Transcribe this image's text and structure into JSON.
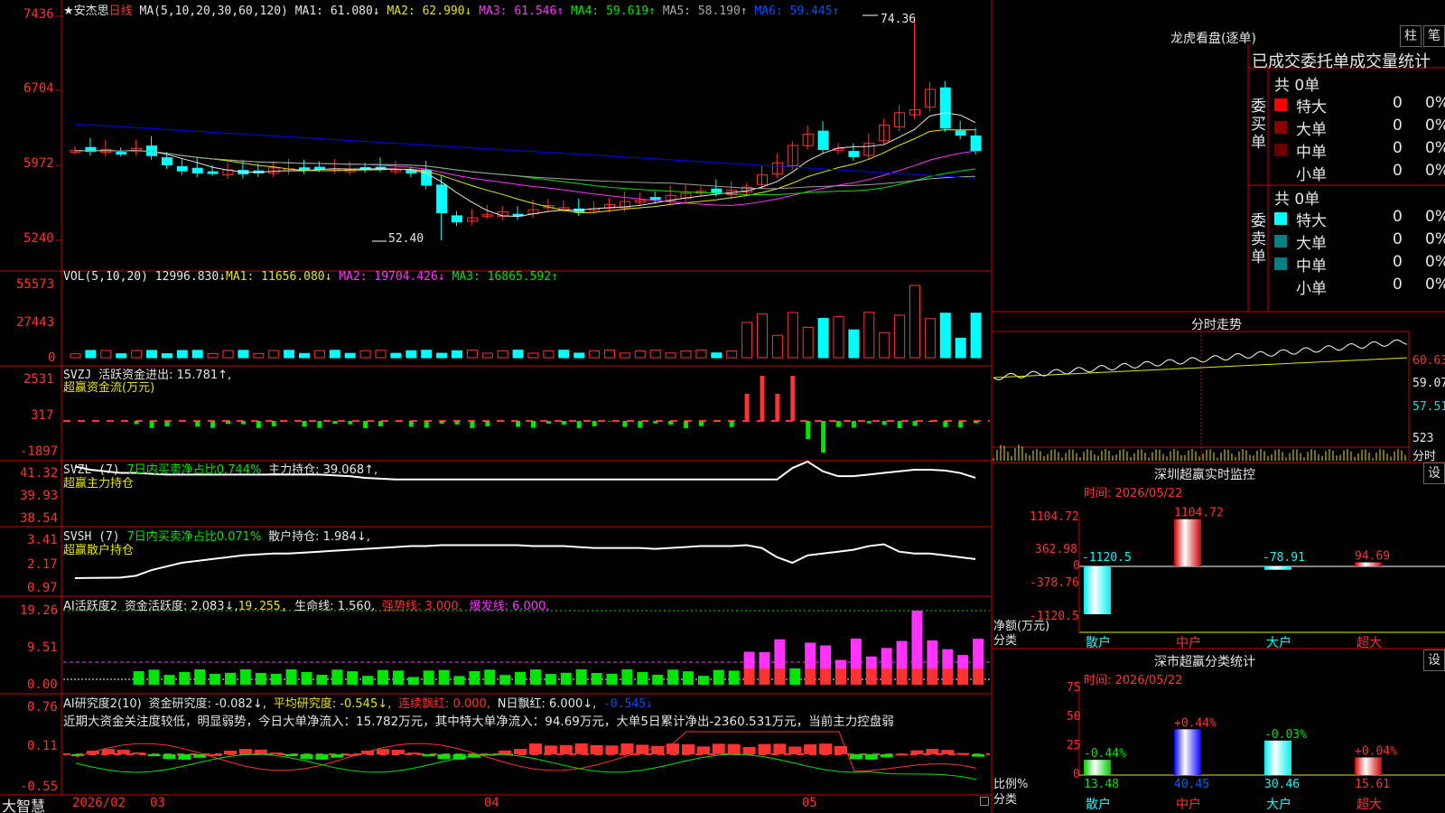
{
  "header": {
    "stock_name": "★安杰思",
    "period": "日线",
    "ma_label": "MA(5,10,20,30,60,120)",
    "ma1": "MA1: 61.080↓",
    "ma2": "MA2: 62.990↓",
    "ma3": "MA3: 61.546↑",
    "ma4": "MA4: 59.619↑",
    "ma5": "MA5: 58.190↑",
    "ma6": "MA6: 59.445↑",
    "high_mark": "74.36",
    "low_mark": "52.40"
  },
  "price_axis": [
    "7436",
    "6704",
    "5972",
    "5240"
  ],
  "vol_panel": {
    "label": "VOL(5,10,20)",
    "value": "12996.830↓",
    "ma1": "MA1: 11656.080↓",
    "ma2": "MA2: 19704.426↓",
    "ma3": "MA3: 16865.592↑",
    "axis": [
      "55573",
      "27443",
      "0"
    ]
  },
  "svzj_panel": {
    "label": "SVZJ",
    "line1": "活跃资金进出: 15.781↑,",
    "line2": "超赢资金流(万元)",
    "axis": [
      "2531",
      "317",
      "-1897"
    ]
  },
  "svzl_panel": {
    "label": "SVZL (7)",
    "t1": "7日内买卖净占比0.744%",
    "t2": "主力持仓: 39.068↑,",
    "line2": "超赢主力持仓",
    "axis": [
      "41.32",
      "39.93",
      "38.54"
    ]
  },
  "svsh_panel": {
    "label": "SVSH (7)",
    "t1": "7日内买卖净占比0.071%",
    "t2": "散户持仓: 1.984↓,",
    "line2": "超赢散户持仓",
    "axis": [
      "3.41",
      "2.17",
      "0.97"
    ]
  },
  "ai_active": {
    "label": "AI活跃度2",
    "t1": "资金活跃度: 2.083↓,",
    "t2": "19.255,",
    "t3": "生命线: 1.560,",
    "t4": "强势线: 3.000,",
    "t5": "爆发线: 6.000,",
    "axis": [
      "19.26",
      "9.51",
      "0.00"
    ]
  },
  "ai_research": {
    "label": "AI研究度2(10)",
    "t1": "资金研究度: -0.082↓,",
    "t2": "平均研究度: -0.545↓,",
    "t3": "连续飘红: 0.000,",
    "t4": "N日飘红: 6.000↓,",
    "t5": "-0.545↓",
    "commentary": "近期大资金关注度较低，明显弱势，今日大单净流入：15.782万元，其中特大单净流入：94.69万元，大单5日累计净出-2360.531万元，当前主力控盘弱",
    "axis": [
      "0.76",
      "0.11",
      "-0.55"
    ]
  },
  "date_axis": {
    "logo": "大智慧",
    "d1": "2026/02",
    "d2": "03",
    "d3": "04",
    "d4": "05"
  },
  "right_top": {
    "title": "龙虎看盘(逐单)",
    "btn1": "柱",
    "btn2": "笔",
    "subtitle": "已成交委托单成交量统计",
    "buy_side": "委买单",
    "sell_side": "委卖单",
    "buy_total": "共 0单",
    "sell_total": "共 0单",
    "buy_rows": [
      {
        "label": "特大",
        "count": "0",
        "pct": "0%",
        "color": "#ff0000"
      },
      {
        "label": "大单",
        "count": "0",
        "pct": "0%",
        "color": "#8b0000"
      },
      {
        "label": "中单",
        "count": "0",
        "pct": "0%",
        "color": "#6b0000"
      },
      {
        "label": "小单",
        "count": "0",
        "pct": "0%",
        "color": ""
      }
    ],
    "sell_rows": [
      {
        "label": "特大",
        "count": "0",
        "pct": "0%",
        "color": "#00ffff"
      },
      {
        "label": "大单",
        "count": "0",
        "pct": "0%",
        "color": "#008080"
      },
      {
        "label": "中单",
        "count": "0",
        "pct": "0%",
        "color": "#008080"
      },
      {
        "label": "小单",
        "count": "0",
        "pct": "0%",
        "color": ""
      }
    ]
  },
  "intraday": {
    "title": "分时走势",
    "axis": [
      "60.63",
      "59.07",
      "57.51",
      "523",
      "分时"
    ]
  },
  "sz_monitor": {
    "title": "深圳超赢实时监控",
    "btn": "设",
    "time": "时间: 2026/05/22",
    "axis": [
      "1104.72",
      "362.98",
      "0",
      "-378.76",
      "-1120.5"
    ],
    "side_label1": "净额(万元)",
    "side_label2": "分类",
    "bars": [
      {
        "cat": "散户",
        "value": -1120.5,
        "label": "-1120.5"
      },
      {
        "cat": "中户",
        "value": 1104.72,
        "label": "1104.72"
      },
      {
        "cat": "大户",
        "value": -78.91,
        "label": "-78.91"
      },
      {
        "cat": "超大",
        "value": 94.69,
        "label": "94.69"
      }
    ]
  },
  "sz_class": {
    "title": "深市超赢分类统计",
    "btn": "设",
    "time": "时间: 2026/05/22",
    "axis": [
      "75",
      "50",
      "25",
      "0"
    ],
    "side_label1": "比例%",
    "side_label2": "分类",
    "bars": [
      {
        "cat": "散户",
        "value": 13.48,
        "label": "13.48",
        "chg": "-0.44%"
      },
      {
        "cat": "中户",
        "value": 40.45,
        "label": "40.45",
        "chg": "+0.44%"
      },
      {
        "cat": "大户",
        "value": 30.46,
        "label": "30.46",
        "chg": "-0.03%"
      },
      {
        "cat": "超大",
        "value": 15.61,
        "label": "15.61",
        "chg": "+0.04%"
      }
    ]
  },
  "colors": {
    "up": "#ff3232",
    "down": "#00ffff",
    "grid": "#c80000",
    "ma1": "#e6e6e6",
    "ma2": "#e6e600",
    "ma3": "#ff32ff",
    "ma4": "#00e600",
    "ma5": "#a0a0a0",
    "ma6": "#0000ff"
  }
}
